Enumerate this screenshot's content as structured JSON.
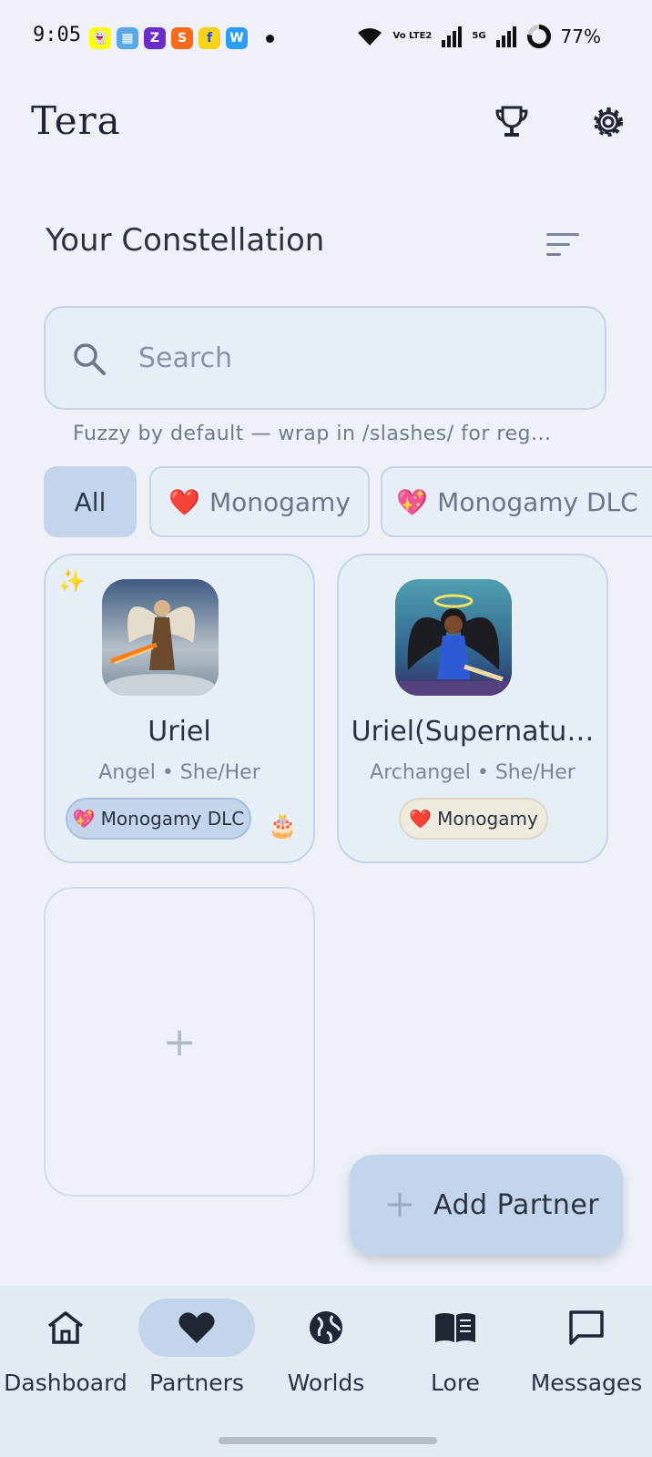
{
  "status_bar": {
    "time": "9:05",
    "battery": "77%",
    "network_volte": "Vo LTE2",
    "network_5g": "5G"
  },
  "header": {
    "title": "Tera"
  },
  "section": {
    "title": "Your Constellation"
  },
  "search": {
    "placeholder": "Search",
    "hint": "Fuzzy by default — wrap in /slashes/ for reg..."
  },
  "filters": [
    {
      "label": "All",
      "emoji": ""
    },
    {
      "label": "Monogamy",
      "emoji": "❤️"
    },
    {
      "label": "Monogamy DLC",
      "emoji": "💖"
    }
  ],
  "partners": [
    {
      "name": "Uriel",
      "subtitle": "Angel • She/Her",
      "badge": "Monogamy DLC",
      "badge_emoji": "💖",
      "birthday_emoji": "🎂",
      "sparkle": "✨"
    },
    {
      "name": "Uriel(Supernatu…",
      "subtitle": "Archangel • She/Her",
      "badge": "Monogamy",
      "badge_emoji": "❤️"
    }
  ],
  "add_card": {
    "symbol": "+"
  },
  "fab": {
    "label": "Add Partner"
  },
  "nav": [
    {
      "label": "Dashboard"
    },
    {
      "label": "Partners"
    },
    {
      "label": "Worlds"
    },
    {
      "label": "Lore"
    },
    {
      "label": "Messages"
    }
  ],
  "colors": {
    "accent": "#c3d5eb",
    "background": "#eef2f8",
    "card": "#e6eef8",
    "text": "#2b3242"
  }
}
